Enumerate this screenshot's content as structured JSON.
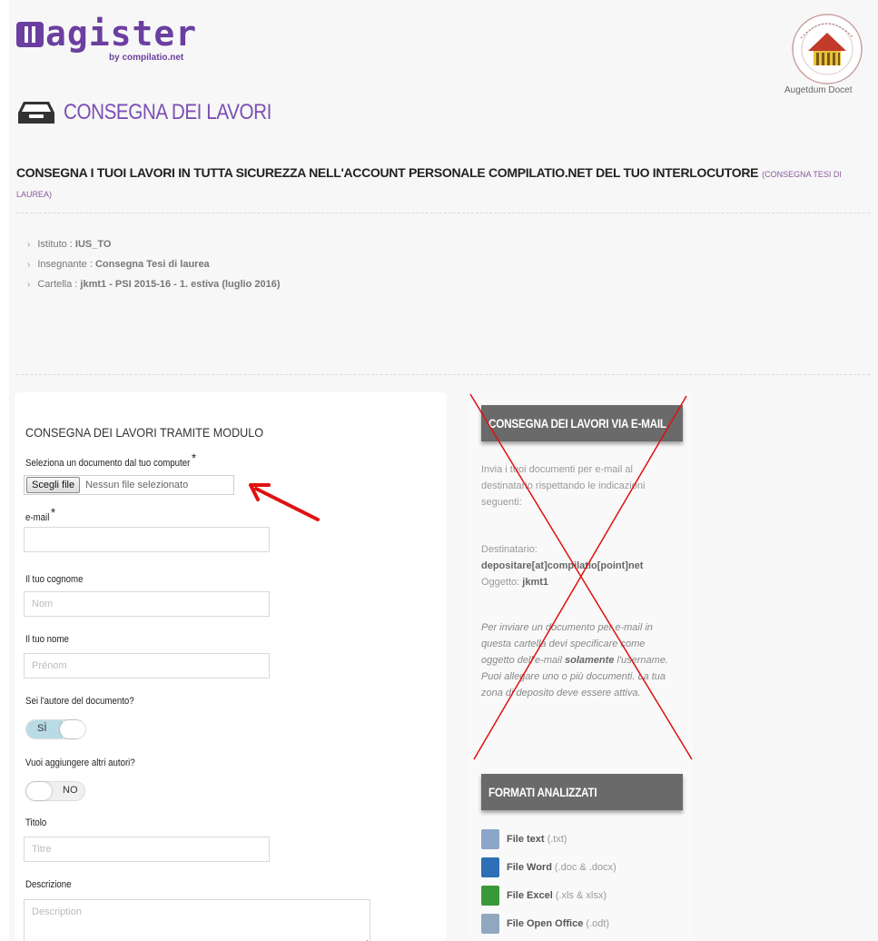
{
  "header": {
    "logo_text": "agister",
    "logo_sub": "by compilatio.net",
    "motto": "Augetdum Docet",
    "page_title": "CONSEGNA DEI LAVORI"
  },
  "subtitle": {
    "main": "CONSEGNA I TUOI LAVORI IN TUTTA SICUREZZA NELL'ACCOUNT PERSONALE COMPILATIO.NET DEL TUO INTERLOCUTORE",
    "small": "(CONSEGNA TESI DI LAUREA)"
  },
  "info": [
    {
      "label": "Istituto : ",
      "value": "IUS_TO"
    },
    {
      "label": "Insegnante : ",
      "value": "Consegna Tesi di laurea"
    },
    {
      "label": "Cartella : ",
      "value": "jkmt1 - PSI 2015-16 - 1. estiva (luglio 2016)"
    }
  ],
  "form": {
    "title": "CONSEGNA DEI LAVORI TRAMITE MODULO",
    "file_label": "Seleziona un documento dal tuo computer",
    "required_mark": "*",
    "file_button": "Scegli file",
    "file_status": "Nessun file selezionato",
    "email_label": "e-mail",
    "email_value": "",
    "surname_label": "Il tuo cognome",
    "surname_placeholder": "Nom",
    "name_label": "Il tuo nome",
    "name_placeholder": "Prénom",
    "author_label": "Sei l'autore del documento?",
    "author_toggle": "SÌ",
    "author_toggle_on": true,
    "coauthors_label": "Vuoi aggiungere altri autori?",
    "coauthors_toggle": "NO",
    "coauthors_toggle_on": false,
    "title_label": "Titolo",
    "title_placeholder": "Titre",
    "desc_label": "Descrizione",
    "desc_placeholder": "Description"
  },
  "email_panel": {
    "heading": "CONSEGNA DEI LAVORI VIA E-MAIL",
    "intro": "Invia i tuoi documenti per e-mail al destinatario rispettando le indicazioni seguenti:",
    "recipient_label": "Destinatario:",
    "recipient_value": "depositare[at]compilatio[point]net",
    "subject_label": "Oggetto: ",
    "subject_value": "jkmt1",
    "note_part1": "Per inviare un documento per e-mail in questa cartella devi specificare come oggetto dell'e-mail ",
    "note_bold": "solamente",
    "note_part2": " l'username. Puoi allegare uno o più documenti. La tua zona di deposito deve essere attiva."
  },
  "formats_panel": {
    "heading": "FORMATI ANALIZZATI",
    "items": [
      {
        "name": "File text",
        "ext": "(.txt)",
        "icon": "txt-file-icon",
        "color": "#8aa6c8"
      },
      {
        "name": "File Word",
        "ext": "(.doc & .docx)",
        "icon": "word-file-icon",
        "color": "#2f6fb5"
      },
      {
        "name": "File Excel",
        "ext": "(.xls & xlsx)",
        "icon": "excel-file-icon",
        "color": "#3a9a3a"
      },
      {
        "name": "File Open Office",
        "ext": "(.odt)",
        "icon": "odt-file-icon",
        "color": "#8fa8c0"
      }
    ]
  },
  "colors": {
    "brand_purple": "#6b3fa0",
    "title_purple": "#7b4fb5",
    "panel_head": "#6a6a6a",
    "annotation_red": "#e01010"
  }
}
